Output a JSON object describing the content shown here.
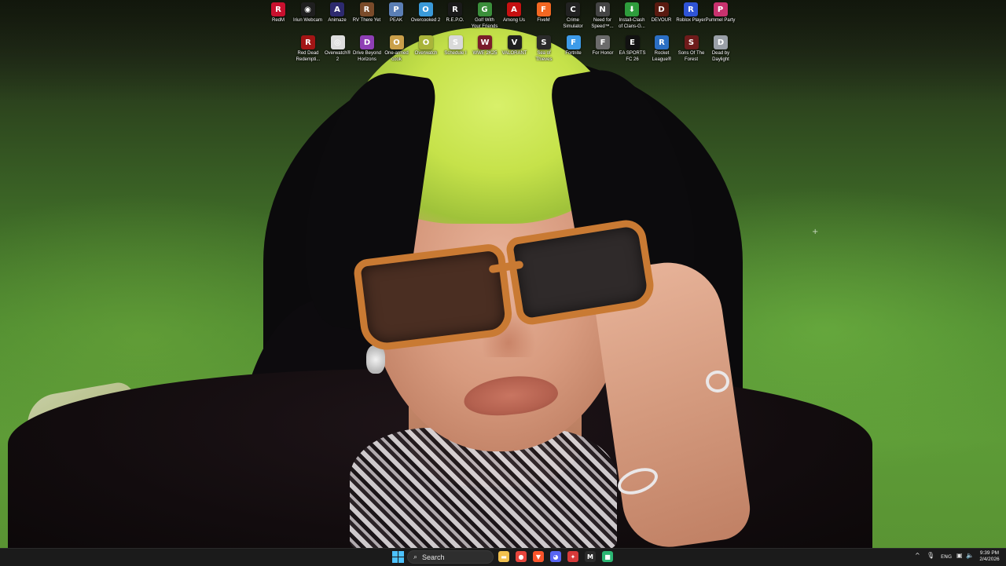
{
  "desktop": {
    "icons_row1": [
      {
        "label": "RedM",
        "name": "redm-icon",
        "color": "#c8102e",
        "glyph": "R"
      },
      {
        "label": "Iriun Webcam",
        "name": "iriun-webcam-icon",
        "color": "#1f1f1f",
        "glyph": "◉"
      },
      {
        "label": "Animaze",
        "name": "animaze-icon",
        "color": "#2d2a6e",
        "glyph": "A"
      },
      {
        "label": "RV There Yet",
        "name": "rv-there-yet-icon",
        "color": "#7a4b2a",
        "glyph": "R"
      },
      {
        "label": "PEAK",
        "name": "peak-icon",
        "color": "#5b7fb5",
        "glyph": "P"
      },
      {
        "label": "Overcooked 2",
        "name": "overcooked-2-icon",
        "color": "#3a9ad9",
        "glyph": "O"
      },
      {
        "label": "R.E.P.O.",
        "name": "repo-icon",
        "color": "#1a1a1a",
        "glyph": "R"
      },
      {
        "label": "Golf With Your Friends",
        "name": "golf-with-your-friends-icon",
        "color": "#3b8f3b",
        "glyph": "G"
      },
      {
        "label": "Among Us",
        "name": "among-us-icon",
        "color": "#c51111",
        "glyph": "A"
      },
      {
        "label": "FiveM",
        "name": "fivem-icon",
        "color": "#f26722",
        "glyph": "F"
      },
      {
        "label": "Crime Simulator",
        "name": "crime-simulator-icon",
        "color": "#222222",
        "glyph": "C"
      },
      {
        "label": "Need for Speed™...",
        "name": "need-for-speed-icon",
        "color": "#444444",
        "glyph": "N"
      },
      {
        "label": "Install-Clash of Clans-G...",
        "name": "install-clash-of-clans-icon",
        "color": "#2e9c3c",
        "glyph": "⬇"
      },
      {
        "label": "DEVOUR",
        "name": "devour-icon",
        "color": "#5a1a10",
        "glyph": "D"
      },
      {
        "label": "Roblox Player",
        "name": "roblox-player-icon",
        "color": "#2f54d6",
        "glyph": "R"
      },
      {
        "label": "Pummel Party",
        "name": "pummel-party-icon",
        "color": "#c8326e",
        "glyph": "P"
      }
    ],
    "icons_row2": [
      {
        "label": "Red Dead Redempti...",
        "name": "red-dead-redemption-icon",
        "color": "#a31515",
        "glyph": "R"
      },
      {
        "label": "Overwatch® 2",
        "name": "overwatch-2-icon",
        "color": "#dddddd",
        "glyph": "◎"
      },
      {
        "label": "Drive Beyond Horizons",
        "name": "drive-beyond-horizons-icon",
        "color": "#8e3fb5",
        "glyph": "D"
      },
      {
        "label": "One-armed cook",
        "name": "one-armed-cook-icon",
        "color": "#caa04a",
        "glyph": "O"
      },
      {
        "label": "Overwatch",
        "name": "overwatch-icon",
        "color": "#a9b43a",
        "glyph": "O"
      },
      {
        "label": "Schedule I",
        "name": "schedule-i-icon",
        "color": "#d9d9d9",
        "glyph": "S"
      },
      {
        "label": "WWE 2K25",
        "name": "wwe-2k25-icon",
        "color": "#7a1c2a",
        "glyph": "W"
      },
      {
        "label": "VALORANT",
        "name": "valorant-icon",
        "color": "#1f1f1f",
        "glyph": "V"
      },
      {
        "label": "Sea of Thieves",
        "name": "sea-of-thieves-icon",
        "color": "#2a2a2a",
        "glyph": "S"
      },
      {
        "label": "Fortnite",
        "name": "fortnite-icon",
        "color": "#3d9be9",
        "glyph": "F"
      },
      {
        "label": "For Honor",
        "name": "for-honor-icon",
        "color": "#6b6b6b",
        "glyph": "F"
      },
      {
        "label": "EA SPORTS FC 26",
        "name": "ea-sports-fc-26-icon",
        "color": "#111111",
        "glyph": "E"
      },
      {
        "label": "Rocket League®",
        "name": "rocket-league-icon",
        "color": "#2b6fc4",
        "glyph": "R"
      },
      {
        "label": "Sons Of The Forest",
        "name": "sons-of-the-forest-icon",
        "color": "#6e1b1b",
        "glyph": "S"
      },
      {
        "label": "Dead by Daylight",
        "name": "dead-by-daylight-icon",
        "color": "#9aa0a8",
        "glyph": "D"
      }
    ]
  },
  "taskbar": {
    "search_label": "Search",
    "search_icon": "⌕",
    "apps": [
      {
        "name": "file-explorer-icon",
        "color": "#f2c14e",
        "glyph": "▬"
      },
      {
        "name": "chrome-icon",
        "color": "#e8453c",
        "glyph": "●"
      },
      {
        "name": "brave-icon",
        "color": "#fb542b",
        "glyph": "▼"
      },
      {
        "name": "discord-icon",
        "color": "#5865f2",
        "glyph": "◕"
      },
      {
        "name": "app-red-icon",
        "color": "#d73a3a",
        "glyph": "✦"
      },
      {
        "name": "capcut-icon",
        "color": "#2b2b2b",
        "glyph": "M"
      },
      {
        "name": "app-green-icon",
        "color": "#2bb673",
        "glyph": "■"
      }
    ],
    "tray": {
      "chevron": "^",
      "mic": "🎙",
      "language": "ENG",
      "network": "▣",
      "volume": "🔈",
      "time": "9:39 PM",
      "date": "2/4/2026"
    }
  }
}
